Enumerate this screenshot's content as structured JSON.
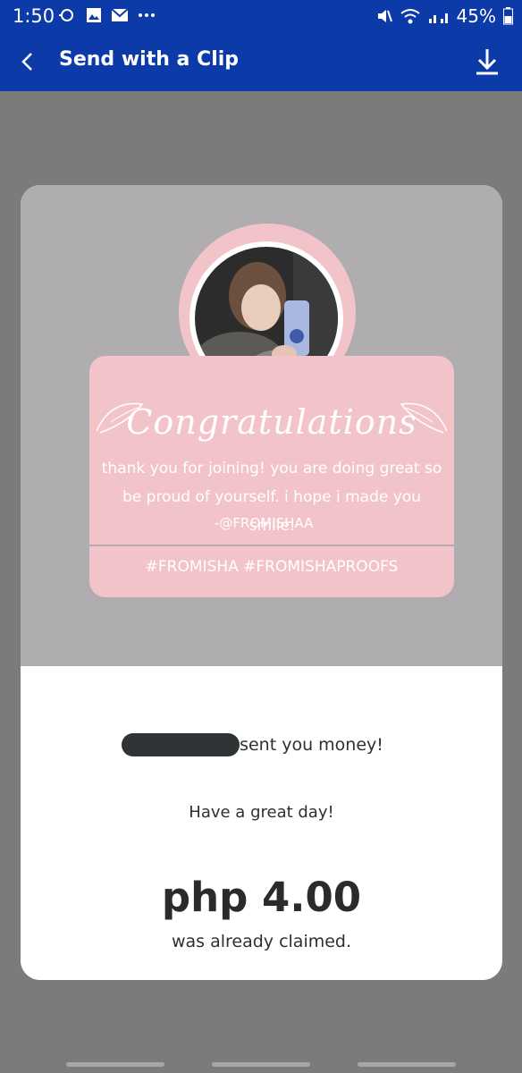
{
  "status_bar": {
    "time": "1:50",
    "battery": "45%"
  },
  "header": {
    "title": "Send with a Clip"
  },
  "clip": {
    "heading": "Congratulations",
    "message_line1": "thank you for joining! you are doing great so",
    "message_line2": "be proud of yourself. i hope i made you smile.",
    "signature": "-@FROMISHAA",
    "hashtags": "#FROMISHA #FROMISHAPROOFS"
  },
  "transfer": {
    "sent_text": "sent you money!",
    "greeting": "Have a great day!",
    "amount": "php 4.00",
    "status": "was already claimed."
  },
  "colors": {
    "brand_blue": "#0c3aa8",
    "clip_pink": "#f2c3c9",
    "clip_gray": "#b0adb1"
  },
  "icons": [
    "back-icon",
    "download-icon",
    "wifi-icon",
    "signal-icon",
    "mute-icon",
    "battery-icon",
    "gallery-icon",
    "mail-icon"
  ]
}
